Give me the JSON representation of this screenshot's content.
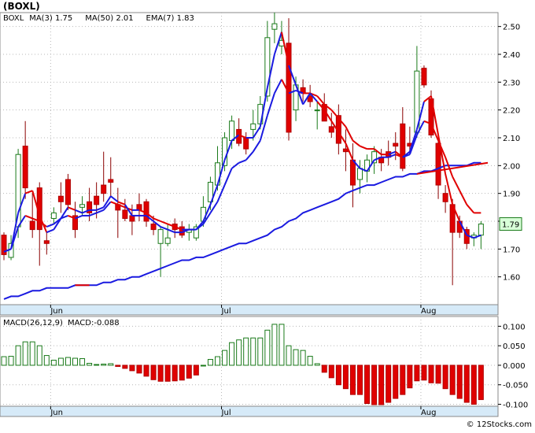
{
  "chart_data": [
    {
      "type": "candlestick",
      "title": "(BOXL)",
      "legend": [
        {
          "label": "BOXL",
          "color": "#1a8a1a"
        },
        {
          "label": "MA(3)",
          "value": "1.75",
          "color": "#1a1ae0"
        },
        {
          "label": "MA(50)",
          "value": "2.01",
          "color": "#1a1ae0"
        },
        {
          "label": "EMA(7)",
          "value": "1.83",
          "color": "#1a1ae0"
        }
      ],
      "last_price_label": "1.79",
      "ylim": [
        1.5,
        2.55
      ],
      "y_ticks": [
        "2.50",
        "2.40",
        "2.30",
        "2.20",
        "2.10",
        "2.00",
        "1.90",
        "1.80",
        "1.70",
        "1.60"
      ],
      "x_labels": [
        {
          "label": "Jun",
          "index": 7
        },
        {
          "label": "Jul",
          "index": 31
        },
        {
          "label": "Aug",
          "index": 59
        }
      ],
      "candles": [
        [
          1.75,
          1.76,
          1.66,
          1.68
        ],
        [
          1.67,
          1.75,
          1.66,
          1.72
        ],
        [
          1.78,
          2.06,
          1.74,
          2.04
        ],
        [
          2.07,
          2.16,
          1.88,
          1.92
        ],
        [
          1.8,
          1.9,
          1.74,
          1.77
        ],
        [
          1.92,
          1.94,
          1.64,
          1.77
        ],
        [
          1.73,
          1.76,
          1.68,
          1.72
        ],
        [
          1.81,
          1.85,
          1.79,
          1.83
        ],
        [
          1.89,
          1.94,
          1.83,
          1.87
        ],
        [
          1.95,
          1.97,
          1.84,
          1.86
        ],
        [
          1.82,
          1.87,
          1.74,
          1.77
        ],
        [
          1.85,
          1.89,
          1.82,
          1.86
        ],
        [
          1.87,
          1.92,
          1.8,
          1.83
        ],
        [
          1.89,
          1.94,
          1.81,
          1.86
        ],
        [
          1.93,
          2.05,
          1.87,
          1.9
        ],
        [
          1.95,
          2.03,
          1.89,
          1.94
        ],
        [
          1.86,
          1.92,
          1.74,
          1.84
        ],
        [
          1.84,
          1.88,
          1.8,
          1.81
        ],
        [
          1.82,
          1.86,
          1.75,
          1.8
        ],
        [
          1.86,
          1.9,
          1.8,
          1.84
        ],
        [
          1.87,
          1.88,
          1.78,
          1.8
        ],
        [
          1.79,
          1.82,
          1.75,
          1.77
        ],
        [
          1.72,
          1.78,
          1.6,
          1.77
        ],
        [
          1.72,
          1.79,
          1.71,
          1.74
        ],
        [
          1.79,
          1.81,
          1.74,
          1.77
        ],
        [
          1.78,
          1.8,
          1.74,
          1.75
        ],
        [
          1.76,
          1.79,
          1.73,
          1.77
        ],
        [
          1.74,
          1.79,
          1.73,
          1.78
        ],
        [
          1.8,
          1.89,
          1.78,
          1.85
        ],
        [
          1.87,
          1.96,
          1.84,
          1.94
        ],
        [
          1.93,
          2.07,
          1.91,
          2.01
        ],
        [
          2.0,
          2.12,
          1.98,
          2.1
        ],
        [
          2.09,
          2.18,
          2.06,
          2.16
        ],
        [
          2.13,
          2.17,
          2.07,
          2.08
        ],
        [
          2.1,
          2.12,
          2.04,
          2.06
        ],
        [
          2.13,
          2.2,
          2.09,
          2.15
        ],
        [
          2.15,
          2.25,
          2.13,
          2.22
        ],
        [
          2.25,
          2.52,
          2.23,
          2.46
        ],
        [
          2.49,
          2.55,
          2.44,
          2.51
        ],
        [
          2.43,
          2.52,
          2.4,
          2.45
        ],
        [
          2.44,
          2.53,
          2.09,
          2.12
        ],
        [
          2.2,
          2.32,
          2.16,
          2.29
        ],
        [
          2.28,
          2.31,
          2.23,
          2.26
        ],
        [
          2.25,
          2.29,
          2.21,
          2.23
        ],
        [
          2.2,
          2.23,
          2.13,
          2.2
        ],
        [
          2.22,
          2.26,
          2.17,
          2.16
        ],
        [
          2.14,
          2.19,
          2.1,
          2.12
        ],
        [
          2.18,
          2.22,
          2.04,
          2.08
        ],
        [
          2.06,
          2.13,
          1.98,
          2.05
        ],
        [
          2.02,
          2.08,
          1.85,
          1.93
        ],
        [
          1.95,
          2.02,
          1.9,
          1.99
        ],
        [
          1.98,
          2.04,
          1.94,
          2.02
        ],
        [
          2.01,
          2.07,
          1.97,
          2.05
        ],
        [
          2.03,
          2.06,
          1.98,
          2.01
        ],
        [
          2.05,
          2.09,
          2.0,
          2.03
        ],
        [
          2.08,
          2.12,
          2.02,
          2.07
        ],
        [
          2.15,
          2.21,
          1.98,
          1.99
        ],
        [
          2.08,
          2.14,
          2.04,
          2.07
        ],
        [
          2.12,
          2.43,
          2.1,
          2.34
        ],
        [
          2.35,
          2.36,
          2.28,
          2.29
        ],
        [
          2.24,
          2.27,
          2.1,
          2.11
        ],
        [
          2.08,
          2.1,
          1.88,
          1.93
        ],
        [
          1.9,
          1.93,
          1.83,
          1.87
        ],
        [
          1.86,
          1.88,
          1.57,
          1.76
        ],
        [
          1.8,
          1.82,
          1.74,
          1.76
        ],
        [
          1.77,
          1.78,
          1.7,
          1.72
        ],
        [
          1.74,
          1.76,
          1.71,
          1.75
        ],
        [
          1.75,
          1.8,
          1.7,
          1.79
        ]
      ],
      "series": [
        {
          "name": "MA(50)",
          "values": [
            1.52,
            1.53,
            1.53,
            1.54,
            1.55,
            1.55,
            1.56,
            1.56,
            1.56,
            1.56,
            1.57,
            1.57,
            1.57,
            1.57,
            1.58,
            1.58,
            1.59,
            1.59,
            1.6,
            1.6,
            1.61,
            1.62,
            1.63,
            1.64,
            1.65,
            1.66,
            1.66,
            1.67,
            1.67,
            1.68,
            1.69,
            1.7,
            1.71,
            1.72,
            1.72,
            1.73,
            1.74,
            1.75,
            1.77,
            1.78,
            1.8,
            1.81,
            1.83,
            1.84,
            1.85,
            1.86,
            1.87,
            1.88,
            1.9,
            1.91,
            1.92,
            1.93,
            1.93,
            1.94,
            1.95,
            1.96,
            1.96,
            1.97,
            1.97,
            1.98,
            1.98,
            1.99,
            2.0,
            2.0,
            2.0,
            2.0,
            2.01,
            2.01
          ]
        },
        {
          "name": "MA(3)",
          "values": [
            1.69,
            1.7,
            1.83,
            1.9,
            1.91,
            1.82,
            1.76,
            1.77,
            1.81,
            1.85,
            1.84,
            1.83,
            1.84,
            1.84,
            1.85,
            1.89,
            1.87,
            1.86,
            1.82,
            1.82,
            1.82,
            1.8,
            1.78,
            1.77,
            1.76,
            1.76,
            1.77,
            1.77,
            1.8,
            1.86,
            1.93,
            2.02,
            2.09,
            2.11,
            2.1,
            2.1,
            2.14,
            2.28,
            2.4,
            2.48,
            2.36,
            2.29,
            2.22,
            2.26,
            2.23,
            2.2,
            2.16,
            2.12,
            2.08,
            2.02,
            1.99,
            1.98,
            2.02,
            2.03,
            2.03,
            2.04,
            2.03,
            2.05,
            2.13,
            2.23,
            2.25,
            2.11,
            1.97,
            1.86,
            1.8,
            1.75,
            1.74,
            1.75
          ]
        },
        {
          "name": "EMA(7)",
          "values": [
            1.69,
            1.7,
            1.78,
            1.82,
            1.81,
            1.8,
            1.78,
            1.79,
            1.81,
            1.82,
            1.81,
            1.82,
            1.82,
            1.83,
            1.84,
            1.87,
            1.86,
            1.85,
            1.84,
            1.84,
            1.83,
            1.81,
            1.8,
            1.79,
            1.78,
            1.77,
            1.77,
            1.77,
            1.79,
            1.83,
            1.87,
            1.93,
            1.99,
            2.01,
            2.02,
            2.05,
            2.09,
            2.18,
            2.26,
            2.31,
            2.26,
            2.27,
            2.26,
            2.26,
            2.25,
            2.22,
            2.2,
            2.17,
            2.14,
            2.09,
            2.07,
            2.06,
            2.06,
            2.04,
            2.04,
            2.05,
            2.03,
            2.04,
            2.11,
            2.16,
            2.15,
            2.09,
            2.03,
            1.96,
            1.91,
            1.86,
            1.83,
            1.83
          ]
        }
      ]
    },
    {
      "type": "bar",
      "title": "MACD(26,12,9)",
      "legend": [
        {
          "label": "MACD(26,12,9)",
          "color": "#1a8a1a"
        },
        {
          "label": "MACD:-0.088",
          "color": "#1a1ae0"
        }
      ],
      "ylim": [
        -0.105,
        0.125
      ],
      "y_ticks": [
        "0.100",
        "0.050",
        "0.000",
        "-0.050",
        "-0.100"
      ],
      "x_labels": [
        {
          "label": "Jun",
          "index": 7
        },
        {
          "label": "Jul",
          "index": 31
        },
        {
          "label": "Aug",
          "index": 59
        }
      ],
      "values": [
        0.022,
        0.023,
        0.05,
        0.06,
        0.06,
        0.05,
        0.025,
        0.013,
        0.018,
        0.02,
        0.018,
        0.017,
        0.005,
        0.002,
        0.003,
        0.004,
        -0.003,
        -0.008,
        -0.014,
        -0.02,
        -0.028,
        -0.037,
        -0.041,
        -0.041,
        -0.04,
        -0.038,
        -0.033,
        -0.025,
        0.0,
        0.015,
        0.022,
        0.038,
        0.058,
        0.065,
        0.07,
        0.07,
        0.07,
        0.09,
        0.105,
        0.105,
        0.05,
        0.04,
        0.038,
        0.023,
        0.004,
        -0.018,
        -0.032,
        -0.05,
        -0.06,
        -0.075,
        -0.075,
        -0.098,
        -0.101,
        -0.101,
        -0.095,
        -0.085,
        -0.075,
        -0.058,
        -0.04,
        -0.038,
        -0.045,
        -0.046,
        -0.06,
        -0.075,
        -0.085,
        -0.095,
        -0.1,
        -0.088
      ]
    }
  ],
  "watermark": "© 12Stocks.com"
}
